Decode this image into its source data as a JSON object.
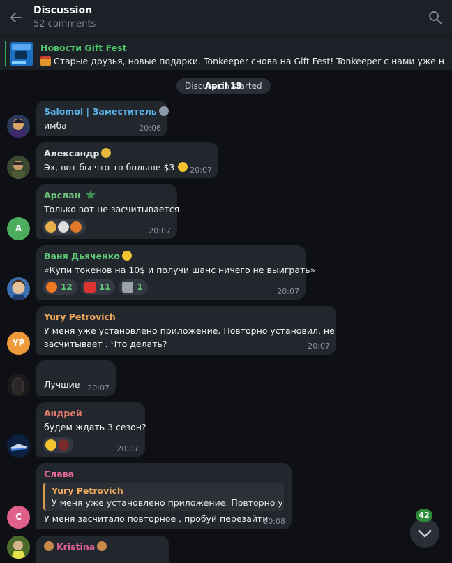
{
  "header": {
    "title": "Discussion",
    "subtitle": "52 comments"
  },
  "pinned": {
    "title": "Новости Gift Fest",
    "text": "Старые друзья, новые подарки. Tonkeeper снова на Gift Fest!  Tonkeeper с нами уже не ..."
  },
  "date_pill": {
    "underlay": "Discussion started",
    "date": "April 13"
  },
  "messages": [
    {
      "name": "Salomol | Заместитель",
      "name_color": "#5bb2e8",
      "text": "имба",
      "time": "20:06"
    },
    {
      "name": "Александр",
      "name_color": "#e6e6e6",
      "text": "Эх, вот бы что-то больше $3",
      "time": "20:07"
    },
    {
      "name": "Арслан",
      "name_color": "#6bc17a",
      "avatar_letter": "A",
      "text": "Только вот не засчитывается",
      "time": "20:07"
    },
    {
      "name": "Ваня Дьяченко",
      "name_color": "#5fca76",
      "text": "«Купи токенов на 10$ и получи шанс ничего не выиграть»",
      "time": "20:07",
      "reactions": [
        {
          "icon": "fire-icon",
          "count": "12"
        },
        {
          "icon": "hundred-icon",
          "count": "11"
        },
        {
          "icon": "moai-icon",
          "count": "1"
        }
      ]
    },
    {
      "name": "Yury Petrovich",
      "name_color": "#f0a85a",
      "avatar_letter": "YP",
      "text_line1": "У меня уже установлено приложение. Повторно установил, не",
      "text_line2": "засчитывает . Что делать?",
      "time": "20:07"
    },
    {
      "text": "Лучшие",
      "time": "20:07"
    },
    {
      "name": "Андрей",
      "name_color": "#e07a6e",
      "text": "будем ждать 3 сезон?",
      "time": "20:07"
    },
    {
      "name": "Слава",
      "name_color": "#e46b9a",
      "avatar_letter": "C",
      "quote_name": "Yury Petrovich",
      "quote_text": "У меня уже установлено приложение. Повторно установил, не засчитывает",
      "text": "У меня засчитало повторное , пробуй перезайти",
      "time": "20:08"
    },
    {
      "name": "Kristina",
      "name_color": "#e0609e",
      "text": ""
    }
  ],
  "unread_count": "42",
  "colors": {
    "background": "#0e1015",
    "bubble": "#22262d",
    "header": "#1c2027",
    "accent_green": "#4fc46a"
  }
}
